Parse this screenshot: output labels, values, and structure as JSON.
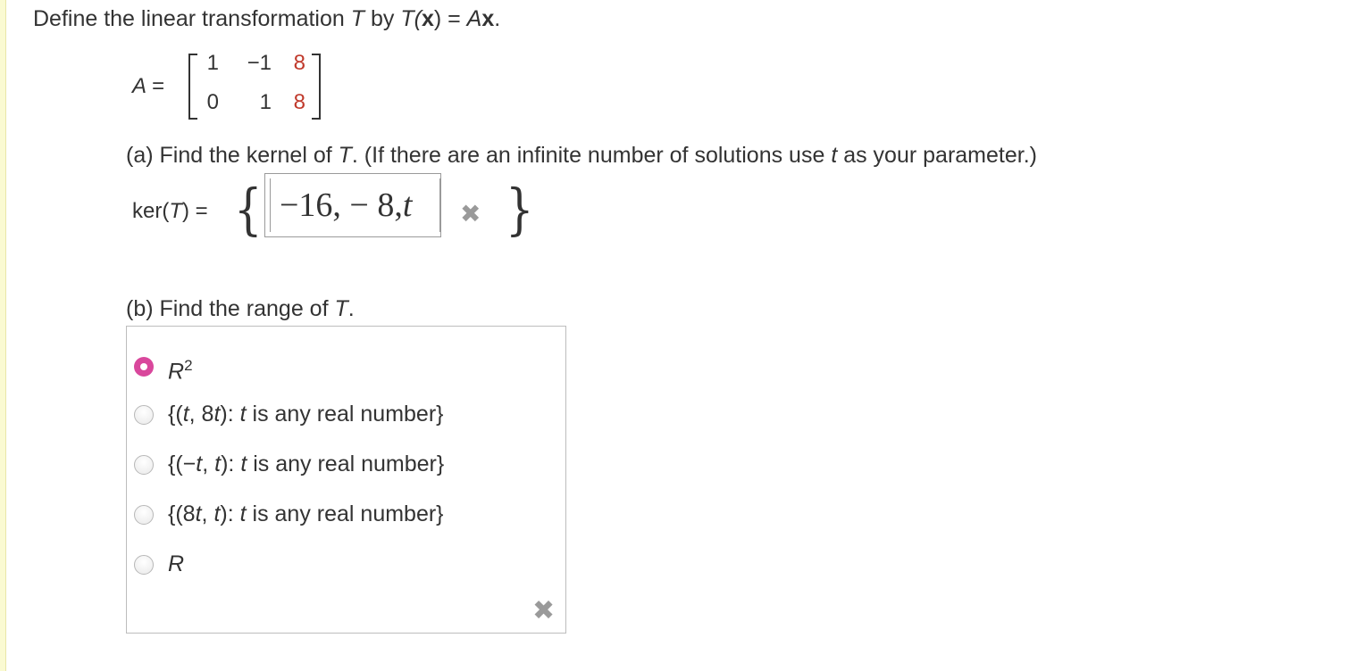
{
  "question": {
    "intro": "Define the linear transformation ",
    "T": "T",
    "by": " by ",
    "Tx": "T(",
    "xbold": "x",
    "close": ")",
    "eq": " = ",
    "A": "A",
    "xend": "x",
    "period": "."
  },
  "matrix": {
    "label": "A =",
    "row1": [
      "1",
      "−1",
      "8"
    ],
    "row2": [
      "0",
      "1",
      "8"
    ]
  },
  "part_a": {
    "prefix": "(a) Find the kernel of ",
    "T": "T",
    "suffix1": ". (If there are an infinite number of solutions use ",
    "t": "t",
    "suffix2": " as your parameter.)",
    "ker_label_pre": "ker(",
    "ker_label_T": "T",
    "ker_label_post": ")  =",
    "brace_open": "{",
    "brace_close": "}",
    "answer_value": "−16, − 8,",
    "answer_t": "t",
    "status_icon": "incorrect-x"
  },
  "part_b": {
    "prefix": "(b) Find the range of ",
    "T": "T",
    "suffix": ".",
    "choices": [
      {
        "base": "R",
        "sup": "2",
        "selected": true
      },
      {
        "pre": "{(",
        "t1": "t",
        "mid": ", 8",
        "t2": "t",
        "post": "): ",
        "t3": "t",
        "tail": " is any real number}",
        "selected": false
      },
      {
        "pre": "{(−",
        "t1": "t",
        "mid": ", ",
        "t2": "t",
        "post": "): ",
        "t3": "t",
        "tail": " is any real number}",
        "selected": false
      },
      {
        "pre": "{(8",
        "t1": "t",
        "mid": ", ",
        "t2": "t",
        "post": "): ",
        "t3": "t",
        "tail": " is any real number}",
        "selected": false
      },
      {
        "base": "R",
        "selected": false
      }
    ],
    "status_icon": "incorrect-x"
  },
  "colors": {
    "selected_radio": "#d9479c",
    "highlight_number": "#c0392b",
    "x_mark": "#9a9a9a"
  }
}
